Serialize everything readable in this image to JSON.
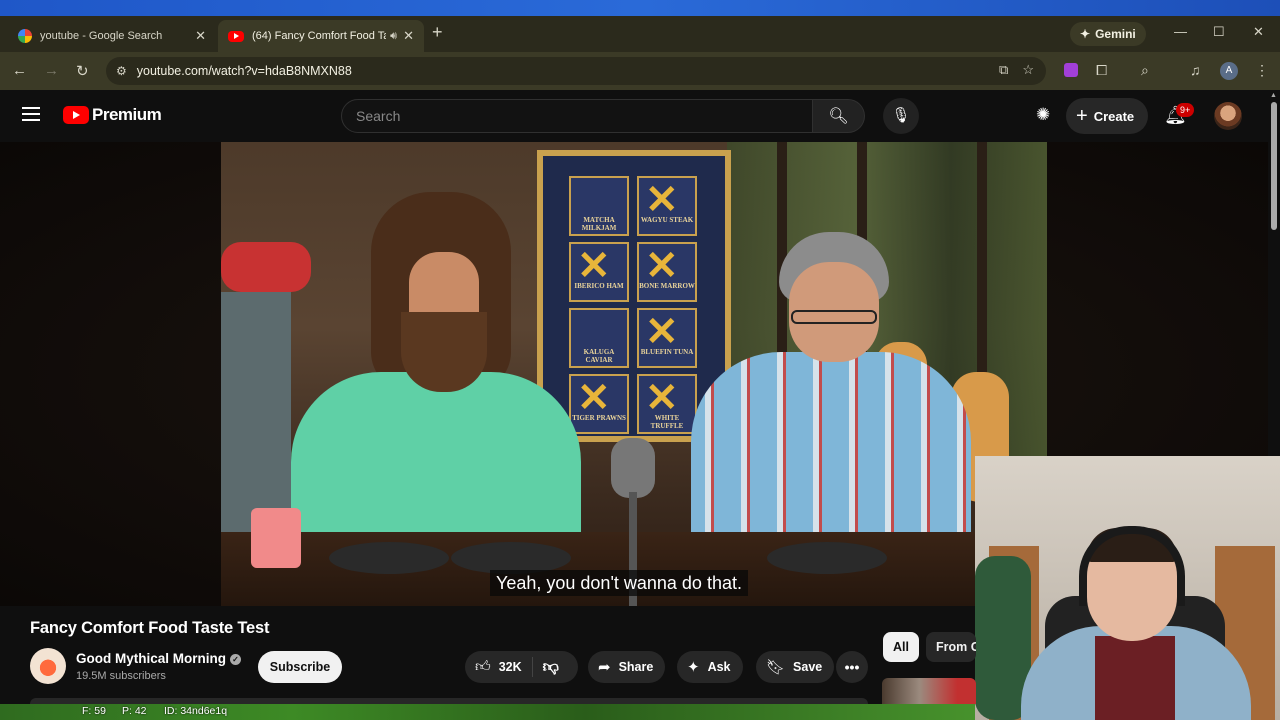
{
  "browser": {
    "tabs": [
      {
        "title": "youtube - Google Search",
        "active": false
      },
      {
        "title": "(64) Fancy Comfort Food Ta",
        "active": true
      }
    ],
    "gemini_label": "Gemini",
    "url": "youtube.com/watch?v=hdaB8NMXN88",
    "profile_initial": "A"
  },
  "youtube": {
    "logo_text": "Premium",
    "search_placeholder": "Search",
    "create_label": "Create",
    "notification_count": "9+"
  },
  "video": {
    "subtitle": "Yeah, you don't wanna do that.",
    "board_tiles": [
      {
        "label": "MATCHA MILKJAM",
        "crossed": false
      },
      {
        "label": "WAGYU STEAK",
        "crossed": true
      },
      {
        "label": "IBERICO HAM",
        "crossed": true
      },
      {
        "label": "BONE MARROW",
        "crossed": true
      },
      {
        "label": "KALUGA CAVIAR",
        "crossed": false
      },
      {
        "label": "BLUEFIN TUNA",
        "crossed": true
      },
      {
        "label": "TIGER PRAWNS",
        "crossed": true
      },
      {
        "label": "WHITE TRUFFLE",
        "crossed": true
      }
    ]
  },
  "details": {
    "title": "Fancy Comfort Food Taste Test",
    "channel_name": "Good Mythical Morning",
    "subscribers": "19.5M subscribers",
    "subscribe_label": "Subscribe",
    "likes": "32K",
    "share_label": "Share",
    "ask_label": "Ask",
    "save_label": "Save"
  },
  "chips": {
    "all": "All",
    "from": "From G"
  },
  "overlay_stats": {
    "f": "F: 59",
    "p": "P: 42",
    "id": "ID: 34nd6e1q"
  }
}
